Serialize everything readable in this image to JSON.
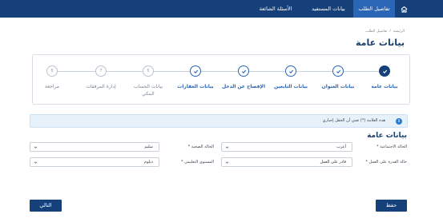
{
  "nav": {
    "tabs": [
      {
        "label": "تفاصيل الطلب",
        "active": true
      },
      {
        "label": "بيانات المستفيد",
        "active": false
      },
      {
        "label": "الأسئلة الشائعة",
        "active": false
      }
    ],
    "home_icon": "home-icon"
  },
  "breadcrumb": {
    "root": "الرئيسة",
    "sep": "/",
    "current": "تفاصيل الطلب"
  },
  "page_title": "بيانات عامة",
  "stepper": {
    "steps": [
      {
        "label": "بيانات عامة",
        "status": "current",
        "marker": "check"
      },
      {
        "label": "بيانات العنوان",
        "status": "done",
        "marker": "check"
      },
      {
        "label": "بيانات التابعين",
        "status": "done",
        "marker": "check"
      },
      {
        "label": "الإفصاح عن الدخل",
        "status": "done",
        "marker": "check"
      },
      {
        "label": "بيانات العقارات",
        "status": "done",
        "marker": "check"
      },
      {
        "label": "بيانات الحساب البنكي",
        "status": "pending",
        "marker": "6"
      },
      {
        "label": "إدارة المرفقات",
        "status": "pending",
        "marker": "7"
      },
      {
        "label": "مراجعة",
        "status": "pending",
        "marker": "8"
      }
    ]
  },
  "notice": {
    "text": "هذه العلامة (*) تعني أن الحقل إجباري",
    "icon": "info-icon"
  },
  "section_title": "بيانات عامة",
  "form": {
    "marital_status": {
      "label": "الحالة الاجتماعية *",
      "value": "أعزب"
    },
    "health_status": {
      "label": "الحالة الصحية *",
      "value": "سليم"
    },
    "work_ability": {
      "label": "حالة القدرة على العمل *",
      "value": "قادر على العمل"
    },
    "education_level": {
      "label": "المستوى التعليمي *",
      "value": "دبلوم"
    }
  },
  "buttons": {
    "save": "حفظ",
    "next": "التالي"
  },
  "colors": {
    "navy": "#16407a",
    "active_tab": "#2b65b5",
    "notice_bg": "#e6f1fa"
  }
}
